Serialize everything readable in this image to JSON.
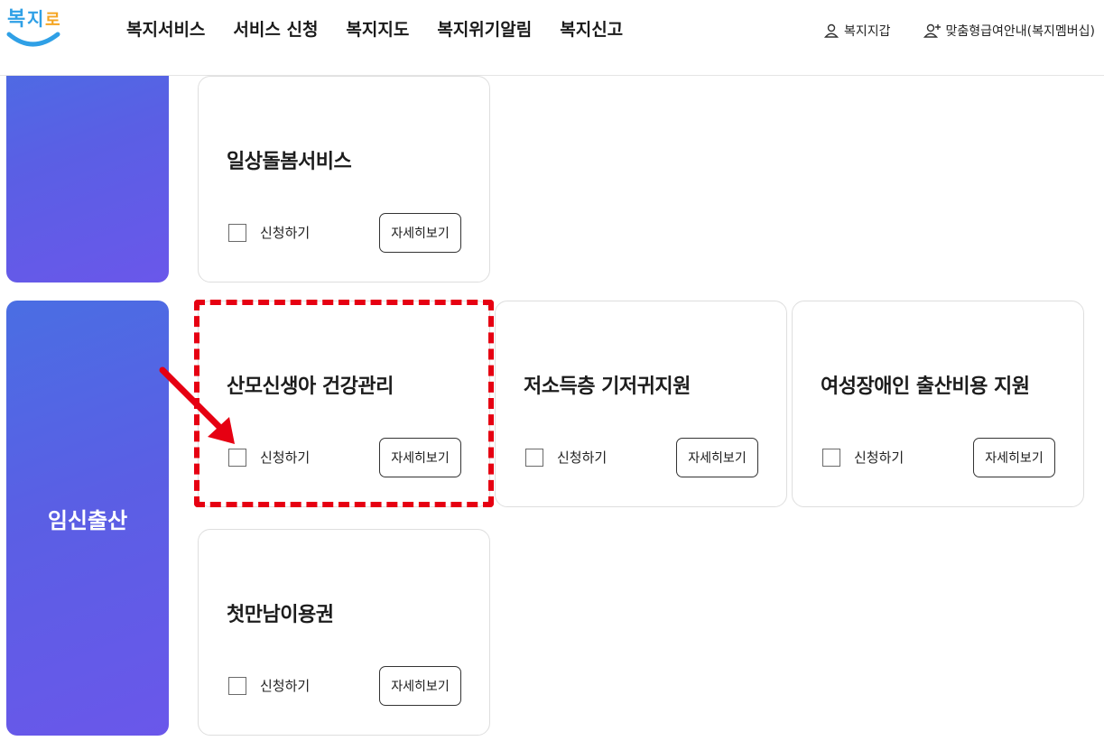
{
  "header": {
    "logo": "복지로",
    "nav": [
      "복지서비스",
      "서비스 신청",
      "복지지도",
      "복지위기알림",
      "복지신고"
    ],
    "wallet_label": "복지지갑",
    "membership_label": "맞춤형급여안내(복지멤버십)"
  },
  "categories": {
    "main_label": "임신출산"
  },
  "cards": [
    {
      "title": "일상돌봄서비스",
      "apply_label": "신청하기",
      "detail_label": "자세히보기"
    },
    {
      "title": "산모신생아 건강관리",
      "apply_label": "신청하기",
      "detail_label": "자세히보기"
    },
    {
      "title": "저소득층 기저귀지원",
      "apply_label": "신청하기",
      "detail_label": "자세히보기"
    },
    {
      "title": "여성장애인 출산비용 지원",
      "apply_label": "신청하기",
      "detail_label": "자세히보기"
    },
    {
      "title": "첫만남이용권",
      "apply_label": "신청하기",
      "detail_label": "자세히보기"
    }
  ],
  "colors": {
    "brand_blue": "#2fa0e6",
    "category_gradient_start": "#4a6ee3",
    "category_gradient_end": "#6a57ea",
    "highlight_red": "#e60012"
  },
  "icons": {
    "wallet": "user-icon",
    "membership": "user-plus-icon"
  }
}
